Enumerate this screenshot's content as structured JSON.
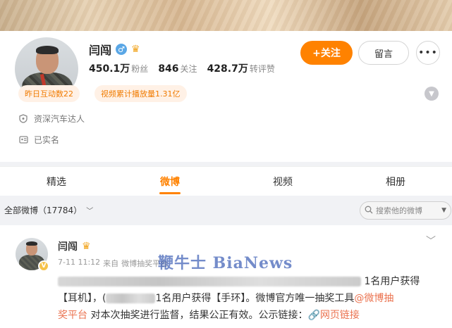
{
  "profile": {
    "name": "闫闯",
    "avatar_badge": "V",
    "stats": [
      {
        "value": "450.1万",
        "label": "粉丝"
      },
      {
        "value": "846",
        "label": "关注"
      },
      {
        "value": "428.7万",
        "label": "转评赞"
      }
    ],
    "follow_label": "+关注",
    "message_label": "留言",
    "more_label": "•••",
    "tags": [
      "昨日互动数22",
      "视频累计播放量1.31亿"
    ],
    "info": [
      {
        "icon": "shield-icon",
        "text": "资深汽车达人"
      },
      {
        "icon": "id-card-icon",
        "text": "已实名"
      }
    ]
  },
  "tabs": [
    {
      "label": "精选",
      "active": false
    },
    {
      "label": "微博",
      "active": true
    },
    {
      "label": "视频",
      "active": false
    },
    {
      "label": "相册",
      "active": false
    }
  ],
  "filter": {
    "label": "全部微博（17784）",
    "search_placeholder": "搜索他的微博"
  },
  "post": {
    "author": "闫闯",
    "time": "7-11 11:12",
    "source_prefix": "来自",
    "source": "微博抽奖平台",
    "watermark": "鞭牛士 BiaNews",
    "line1_tail": "1名用户获得",
    "line2_a": "【耳机】，(",
    "line2_b": "1名用户获得【手环】。微博官方唯一抽奖工具",
    "line2_link": "@微博抽",
    "line3_link": "奖平台",
    "line3_text": "对本次抽奖进行监督，结果公正有效。公示链接：",
    "line3_link2": "网页链接"
  },
  "colors": {
    "accent": "#ff8200",
    "tag_bg": "#fff1e6",
    "link": "#eb7350"
  }
}
